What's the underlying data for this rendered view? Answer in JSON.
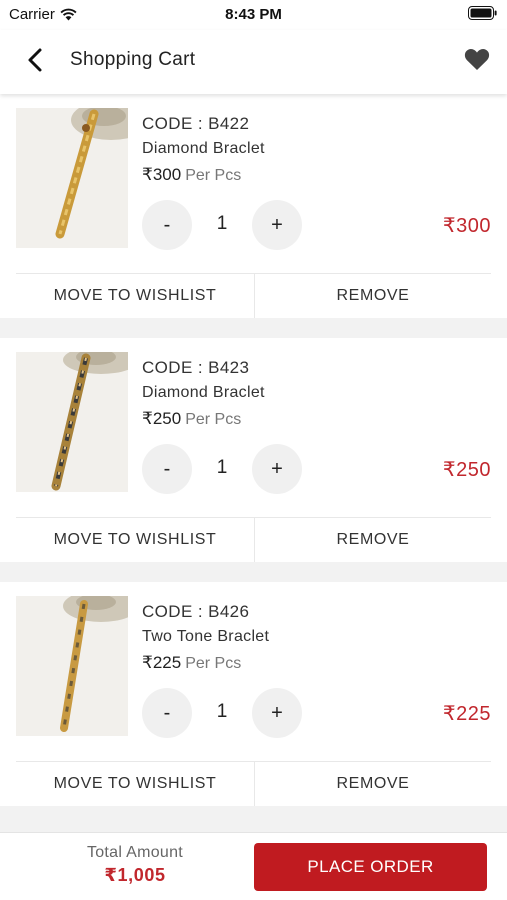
{
  "status_bar": {
    "carrier": "Carrier",
    "time": "8:43 PM"
  },
  "header": {
    "title": "Shopping Cart"
  },
  "items": [
    {
      "code": "CODE : B422",
      "name": "Diamond Braclet",
      "price": "₹300",
      "unit": "Per Pcs",
      "quantity": "1",
      "total": "₹300",
      "move_label": "MOVE TO WISHLIST",
      "remove_label": "REMOVE"
    },
    {
      "code": "CODE : B423",
      "name": "Diamond Braclet",
      "price": "₹250",
      "unit": "Per Pcs",
      "quantity": "1",
      "total": "₹250",
      "move_label": "MOVE TO WISHLIST",
      "remove_label": "REMOVE"
    },
    {
      "code": "CODE : B426",
      "name": "Two Tone Braclet",
      "price": "₹225",
      "unit": "Per Pcs",
      "quantity": "1",
      "total": "₹225",
      "move_label": "MOVE TO WISHLIST",
      "remove_label": "REMOVE"
    }
  ],
  "qty_controls": {
    "minus": "-",
    "plus": "+"
  },
  "footer": {
    "total_label": "Total Amount",
    "total_value": "₹1,005",
    "place_order": "PLACE ORDER"
  },
  "colors": {
    "accent": "#c01b20",
    "price_red": "#c1272d"
  }
}
